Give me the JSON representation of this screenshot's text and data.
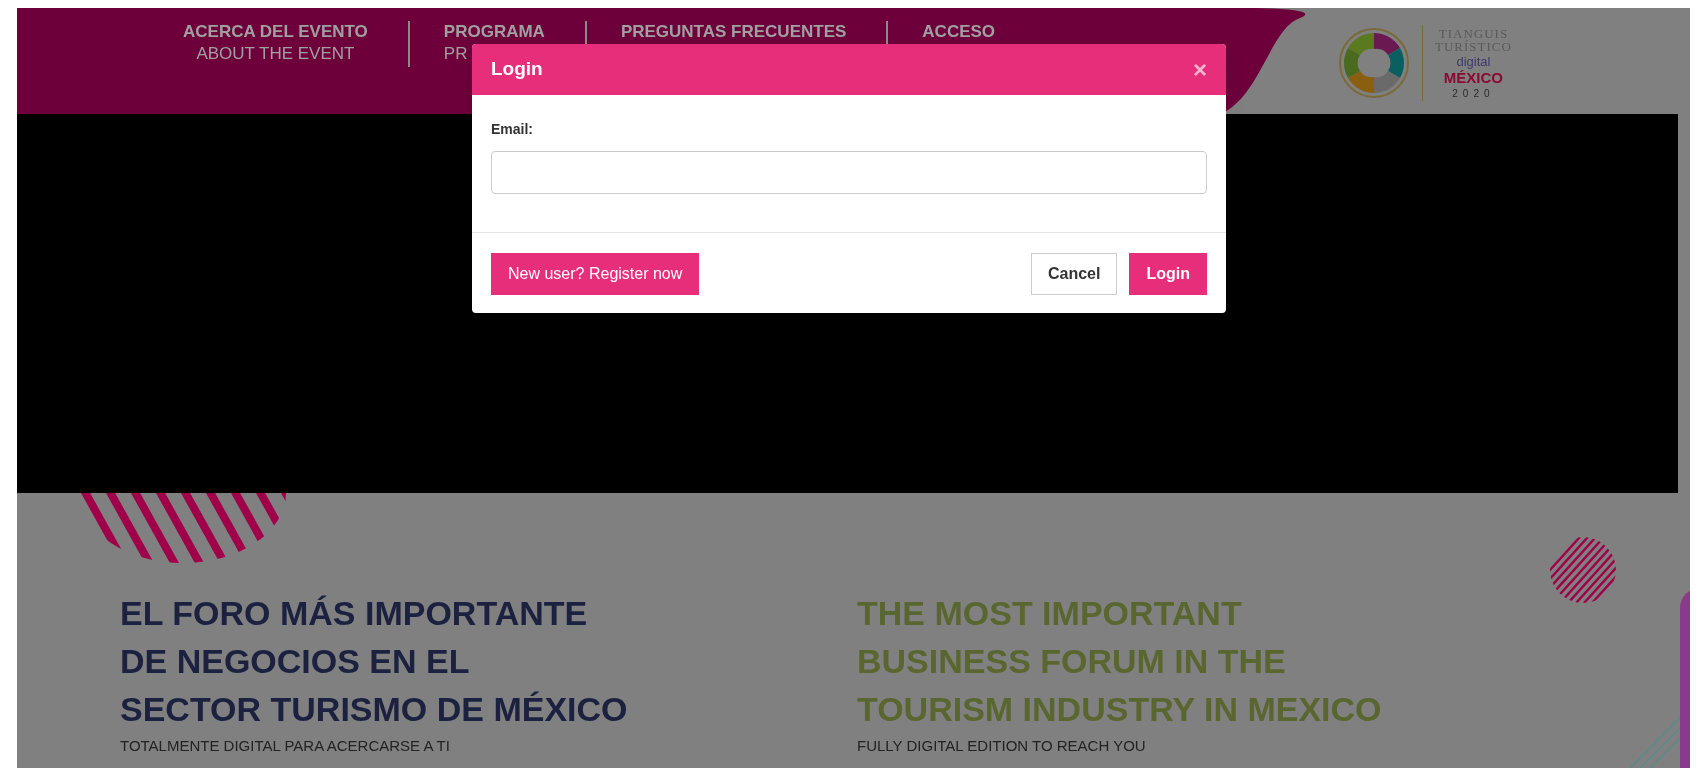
{
  "nav": [
    {
      "title": "ACERCA DEL EVENTO",
      "subtitle": "ABOUT THE EVENT"
    },
    {
      "title": "PROGRAMA",
      "subtitle": "PR"
    },
    {
      "title": "PREGUNTAS FRECUENTES"
    },
    {
      "title": "ACCESO"
    }
  ],
  "logo": {
    "line_1": "TIANGUIS",
    "line_2": "TURÍSTICO",
    "line_3": "digital",
    "line_4": "MÉXICO",
    "line_5": "2020"
  },
  "modal": {
    "title": "Login",
    "close": "×",
    "email_label": "Email:",
    "buttons": [
      {
        "label": "New user? Register now",
        "kind": "primary"
      },
      {
        "label": "Cancel",
        "kind": "secondary"
      },
      {
        "label": "Login",
        "kind": "primary"
      }
    ]
  },
  "hero": [
    {
      "heading": [
        "EL FORO MÁS IMPORTANTE",
        "DE NEGOCIOS EN EL",
        "SECTOR TURISMO DE MÉXICO"
      ],
      "subtitle": "TOTALMENTE DIGITAL PARA ACERCARSE A TI",
      "kind": "spanish"
    },
    {
      "heading": [
        "THE MOST IMPORTANT",
        "BUSINESS FORUM IN THE",
        "TOURISM INDUSTRY IN MEXICO"
      ],
      "subtitle": "FULLY DIGITAL EDITION TO REACH YOU",
      "kind": "english"
    }
  ]
}
